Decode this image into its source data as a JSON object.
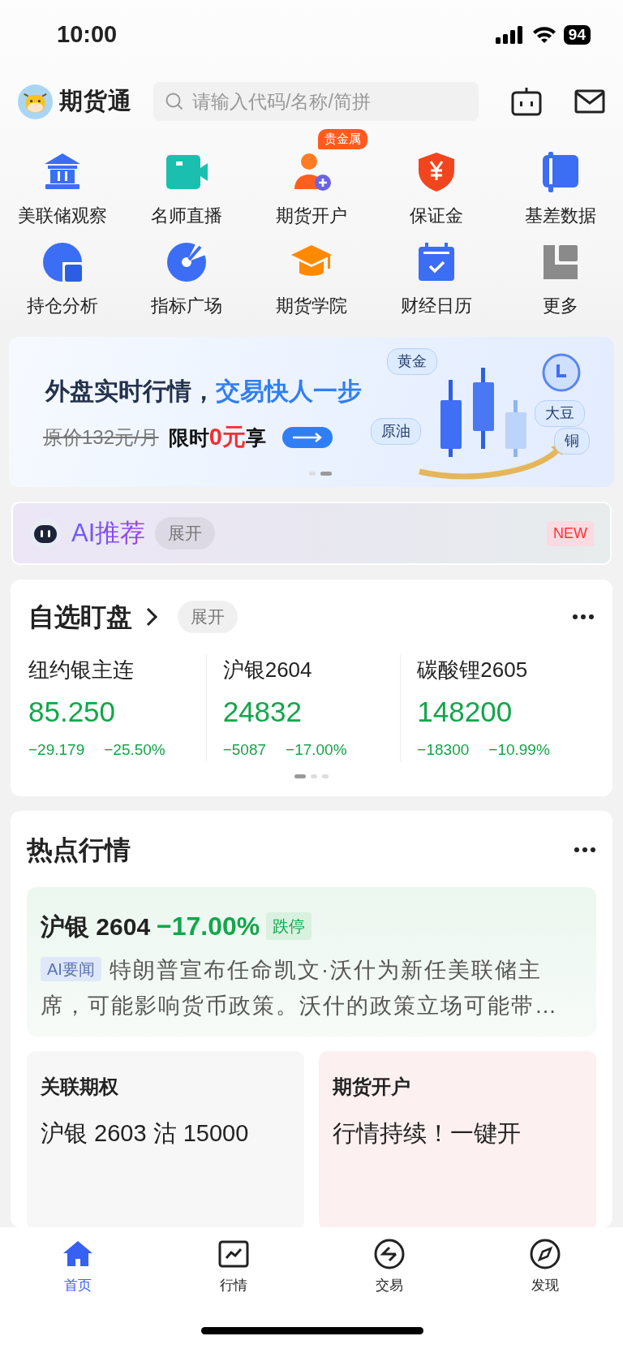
{
  "status_bar": {
    "time": "10:00",
    "battery": "94"
  },
  "header": {
    "app_name": "期货通",
    "search": {
      "placeholder": "请输入代码/名称/简拼"
    }
  },
  "shortcuts": [
    {
      "label": "美联储观察",
      "kind": "bank"
    },
    {
      "label": "名师直播",
      "kind": "video"
    },
    {
      "label": "期货开户",
      "kind": "account",
      "badge": "贵金属"
    },
    {
      "label": "保证金",
      "kind": "shield"
    },
    {
      "label": "基差数据",
      "kind": "basis"
    },
    {
      "label": "持仓分析",
      "kind": "pie"
    },
    {
      "label": "指标广场",
      "kind": "gauge"
    },
    {
      "label": "期货学院",
      "kind": "cap"
    },
    {
      "label": "财经日历",
      "kind": "calendar"
    },
    {
      "label": "更多",
      "kind": "more"
    }
  ],
  "banner": {
    "title": "外盘实时行情，",
    "title_accent": "交易快人一步",
    "old_price": "原价132元/月",
    "offer_prefix": "限时",
    "offer_price": "0元",
    "offer_suffix": "享",
    "tags": [
      "黄金",
      "原油",
      "大豆",
      "铜"
    ],
    "pages": [
      {
        "selected": false
      },
      {
        "selected": true
      }
    ]
  },
  "ai_bar": {
    "title": "AI推荐",
    "toggle": "展开",
    "badge": "NEW"
  },
  "watchlist": {
    "title": "自选盯盘",
    "toggle": "展开",
    "quotes": [
      {
        "name": "纽约银主连",
        "price": "85.250",
        "change": "−29.179",
        "percent": "−25.50%"
      },
      {
        "name": "沪银2604",
        "price": "24832",
        "change": "−5087",
        "percent": "−17.00%"
      },
      {
        "name": "碳酸锂2605",
        "price": "148200",
        "change": "−18300",
        "percent": "−10.99%"
      }
    ],
    "pages": [
      {
        "selected": true
      },
      {
        "selected": false
      },
      {
        "selected": false
      }
    ]
  },
  "hot": {
    "title": "热点行情",
    "featured": {
      "name": "沪银 2604",
      "change": "−17.00%",
      "tag": "跌停",
      "news_tag": "AI要闻",
      "news": "特朗普宣布任命凯文·沃什为新任美联储主席，可能影响货币政策。沃什的政策立场可能带…"
    },
    "cards": [
      {
        "title": "关联期权",
        "text": "沪银 2603 沽 15000"
      },
      {
        "title": "期货开户",
        "text": "行情持续！一键开"
      }
    ]
  },
  "tabs": [
    {
      "label": "首页",
      "kind": "home",
      "selected": true
    },
    {
      "label": "行情",
      "kind": "chart",
      "selected": false
    },
    {
      "label": "交易",
      "kind": "trade",
      "selected": false
    },
    {
      "label": "发现",
      "kind": "compass",
      "selected": false
    }
  ]
}
